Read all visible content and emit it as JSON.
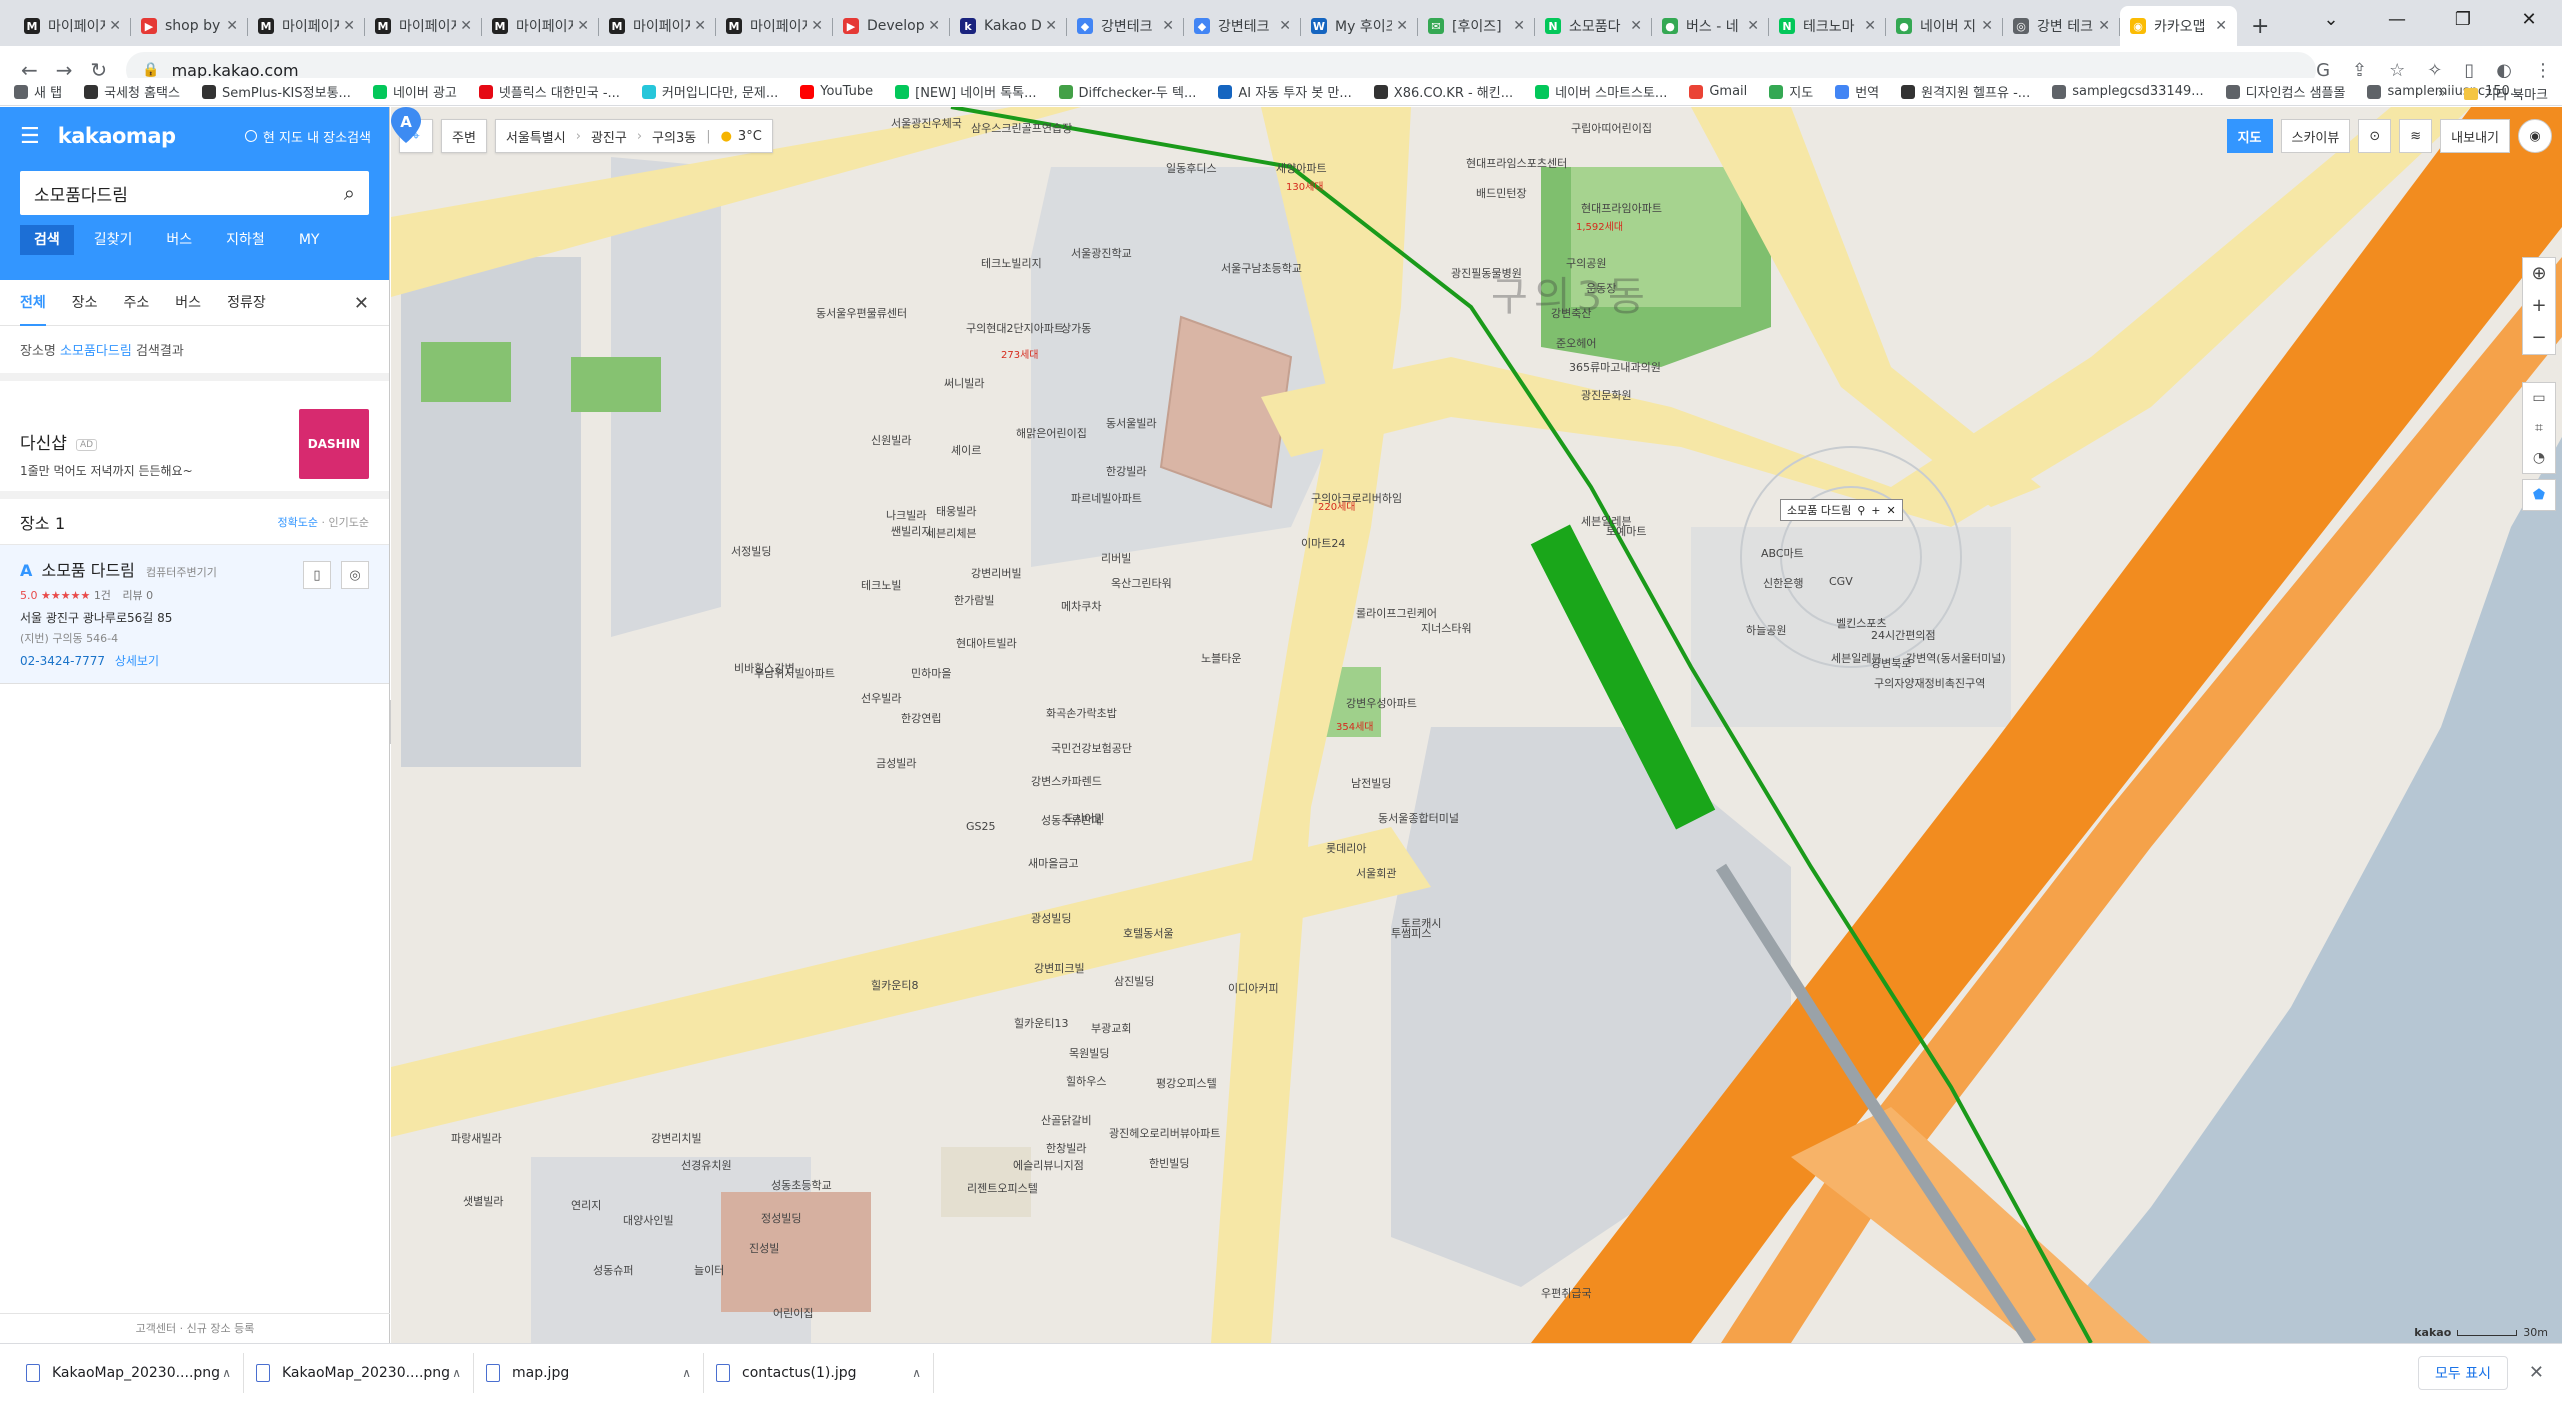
{
  "browser": {
    "tabs": [
      {
        "label": "마이페이지",
        "icon": "M",
        "color": "#222"
      },
      {
        "label": "shop by",
        "icon": "▶",
        "color": "#e53935"
      },
      {
        "label": "마이페이지",
        "icon": "M",
        "color": "#222"
      },
      {
        "label": "마이페이지",
        "icon": "M",
        "color": "#222"
      },
      {
        "label": "마이페이지",
        "icon": "M",
        "color": "#222"
      },
      {
        "label": "마이페이지",
        "icon": "M",
        "color": "#222"
      },
      {
        "label": "마이페이지",
        "icon": "M",
        "color": "#222"
      },
      {
        "label": "Developm",
        "icon": "▶",
        "color": "#e53935"
      },
      {
        "label": "Kakao De",
        "icon": "k",
        "color": "#1a237e"
      },
      {
        "label": "강변테크",
        "icon": "◆",
        "color": "#4285f4"
      },
      {
        "label": "강변테크",
        "icon": "◆",
        "color": "#4285f4"
      },
      {
        "label": "My 후이즈",
        "icon": "W",
        "color": "#1565c0"
      },
      {
        "label": "[후이즈]",
        "icon": "✉",
        "color": "#34a853"
      },
      {
        "label": "소모품다",
        "icon": "N",
        "color": "#03c75a"
      },
      {
        "label": "버스 - 네",
        "icon": "●",
        "color": "#34a853"
      },
      {
        "label": "테크노마",
        "icon": "N",
        "color": "#03c75a"
      },
      {
        "label": "네이버 지",
        "icon": "●",
        "color": "#34a853"
      },
      {
        "label": "강변 테크",
        "icon": "◎",
        "color": "#5f6368"
      },
      {
        "label": "카카오맵",
        "icon": "◉",
        "color": "#fbbc04"
      }
    ],
    "new_tab": "+",
    "url": "map.kakao.com",
    "bookmarks": [
      {
        "label": "새 탭",
        "color": "#5f6368"
      },
      {
        "label": "국세청 홈택스",
        "color": "#333"
      },
      {
        "label": "SemPlus-KIS정보통...",
        "color": "#333"
      },
      {
        "label": "네이버 광고",
        "color": "#03c75a"
      },
      {
        "label": "넷플릭스 대한민국 -...",
        "color": "#e50914"
      },
      {
        "label": "커머입니다만, 문제...",
        "color": "#26c6da"
      },
      {
        "label": "YouTube",
        "color": "#ff0000"
      },
      {
        "label": "[NEW] 네이버 톡톡...",
        "color": "#03c75a"
      },
      {
        "label": "Diffchecker-두 텍...",
        "color": "#43a047"
      },
      {
        "label": "AI 자동 투자 봇 만...",
        "color": "#1565c0"
      },
      {
        "label": "X86.CO.KR - 해킨...",
        "color": "#333"
      },
      {
        "label": "네이버 스마트스토...",
        "color": "#03c75a"
      },
      {
        "label": "Gmail",
        "color": "#ea4335"
      },
      {
        "label": "지도",
        "color": "#34a853"
      },
      {
        "label": "번역",
        "color": "#4285f4"
      },
      {
        "label": "원격지원 헬프유 -...",
        "color": "#333"
      },
      {
        "label": "samplegcsd33149...",
        "color": "#5f6368"
      },
      {
        "label": "디자인컴스 샘플몰",
        "color": "#5f6368"
      },
      {
        "label": "samplemiiusnc150...",
        "color": "#5f6368"
      }
    ],
    "bookmarks_more": "»",
    "bookmarks_folder": "기타 북마크"
  },
  "panel": {
    "logo": "kakaomap",
    "current_map_search": "현 지도 내 장소검색",
    "search_value": "소모품다드림",
    "main_tabs": [
      "검색",
      "길찾기",
      "버스",
      "지하철",
      "MY"
    ],
    "sub_tabs": [
      "전체",
      "장소",
      "주소",
      "버스",
      "정류장"
    ],
    "result_prefix": "장소명",
    "result_keyword": "소모품다드림",
    "result_suffix": "검색결과",
    "ad": {
      "name": "다신샵",
      "badge": "AD",
      "desc": "1줄만 먹어도 저녁까지 든든해요~",
      "thumb": "DASHIN"
    },
    "places_title": "장소",
    "places_count": "1",
    "sort_accuracy": "정확도순",
    "sort_popular": "인기도순",
    "result": {
      "marker": "A",
      "name": "소모품 다드림",
      "category": "컴퓨터주변기기",
      "score": "5.0",
      "stars": "★★★★★",
      "review_count": "1건",
      "review": "리뷰 0",
      "address": "서울 광진구 광나루로56길 85",
      "address_jibun": "(지번) 구의동 546-4",
      "phone": "02-3424-7777",
      "detail": "상세보기"
    },
    "footer": "고객센터 · 신규 장소 등록"
  },
  "map": {
    "toolbar": {
      "nearby": "주변",
      "city": "서울특별시",
      "district": "광진구",
      "dong": "구의3동",
      "weather": "3°C"
    },
    "views": [
      "지도",
      "스카이뷰"
    ],
    "export": "내보내기",
    "popup_title": "소모품 다드림",
    "popup_marker": "A",
    "area_label": "구의3동",
    "scale": "30m",
    "brand": "kakao",
    "colors": {
      "road_main": "#f28c1f",
      "road_secondary": "#f6e7a6",
      "river": "#b6c6d3",
      "park": "#7fbf6e",
      "subway": "#1a9a1a"
    },
    "labels": [
      "서울광진우체국",
      "삼우스크린골프연습장",
      "일동후디스",
      "세양아파트",
      "130세대",
      "현대프라임스포츠센터",
      "배드민턴장",
      "구의공원",
      "운동장",
      "광진필동물병원",
      "강변축산",
      "준오헤어",
      "365류마고내과의원",
      "광진문화원",
      "현대프라임아파트",
      "1,592세대",
      "구립아띠어린이집",
      "서울광진학교",
      "서울구남초등학교",
      "테크노빌리지",
      "구의현대2단지아파트",
      "273세대",
      "상가동",
      "동서울우편물류센터",
      "써니빌라",
      "해맑은어린이집",
      "동서울빌라",
      "한강빌라",
      "셰이르",
      "신원빌라",
      "나크빌라",
      "쌘빌리지",
      "태웅빌라",
      "파르네빌아파트",
      "세븐리체븐",
      "서정빌딩",
      "강변리버빌",
      "리버빌",
      "옥산그린타워",
      "테크노빌",
      "한가람빌",
      "메차쿠차",
      "현대아트빌라",
      "노블타운",
      "비바힐스강변",
      "우남위시빌아파트",
      "선우빌라",
      "민하마을",
      "한강연립",
      "금성빌라",
      "구의아크로리버하임",
      "220세대",
      "이마트24",
      "지너스타워",
      "롤라이프그린케어",
      "강변우성아파트",
      "354세대",
      "화곡손가락초밥",
      "국민건강보험공단",
      "강변스카파렌드",
      "성동주류판매",
      "GS25",
      "도시어민",
      "새마을금고",
      "남전빌딩",
      "동서울종합터미널",
      "롯데리아",
      "서울회관",
      "투썸피스",
      "토르캐시",
      "광성빌딩",
      "호텔동서울",
      "이디아커피",
      "강변피크빌",
      "삼진빌딩",
      "힐카운티8",
      "힐카운티13",
      "부광교회",
      "목원빌딩",
      "힐하우스",
      "평강오피스텔",
      "광진헤오로리버뷰아파트",
      "한빈빌딩",
      "산골닭갈비",
      "한창빌라",
      "선경유치원",
      "성동초등학교",
      "정성빌딩",
      "파랑새빌라",
      "강변리치빌",
      "샛별빌라",
      "연리지",
      "대양사인빌",
      "진성빌",
      "성동슈퍼",
      "늘이터",
      "어린이집",
      "리젠트오피스텔",
      "에슬리뷰니지점",
      "우편취급국",
      "토예마트",
      "세븐일레븐",
      "ABC마트",
      "신한은행",
      "하늘공원",
      "CGV",
      "벨킨스포츠",
      "24시간편의점",
      "강변역(동서울터미널)",
      "세븐일레븐",
      "강변북로",
      "구의자양재정비촉진구역"
    ]
  }
}
